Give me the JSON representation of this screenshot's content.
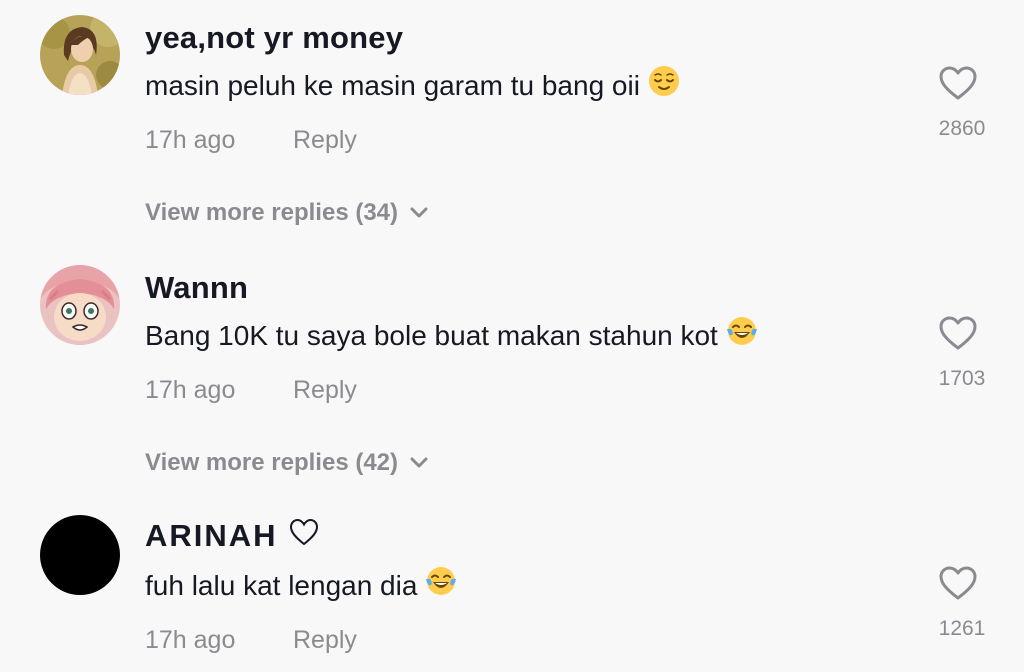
{
  "comments": [
    {
      "username": "yea,not yr money",
      "text": "masin peluh ke masin garam tu bang oii",
      "emoji": "relieved-face",
      "time": "17h ago",
      "reply_label": "Reply",
      "likes": "2860",
      "view_more": "View more replies (34)"
    },
    {
      "username": "Wannn",
      "text": "Bang 10K tu saya bole buat makan stahun kot",
      "emoji": "tears-of-joy",
      "time": "17h ago",
      "reply_label": "Reply",
      "likes": "1703",
      "view_more": "View more replies (42)"
    },
    {
      "username": "ARINAH",
      "text": "fuh lalu kat lengan dia",
      "emoji": "tears-of-joy",
      "time": "17h ago",
      "reply_label": "Reply",
      "likes": "1261"
    }
  ],
  "colors": {
    "text": "#161823",
    "muted": "#8a8b91",
    "background": "#f8f8f8"
  }
}
